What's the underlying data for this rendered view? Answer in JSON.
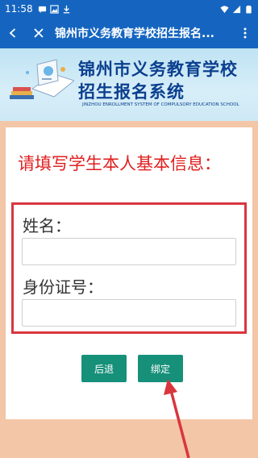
{
  "status_bar": {
    "time": "11:58",
    "left_icons": [
      "message-icon",
      "image-icon",
      "download-icon"
    ],
    "right_icons": [
      "wifi-icon",
      "signal-icon",
      "battery-icon"
    ]
  },
  "nav": {
    "title": "锦州市义务教育学校招生报名...",
    "back_icon": "chevron-left-icon",
    "close_icon": "close-icon",
    "more_icon": "more-vertical-icon"
  },
  "banner": {
    "title_line1": "锦州市义务教育学校",
    "title_line2": "招生报名系统",
    "subtitle": "JINZHOU ENROLLMENT SYSTEM OF COMPULSORY EDUCATION SCHOOL"
  },
  "form": {
    "prompt": "请填写学生本人基本信息：",
    "name_label": "姓名：",
    "name_value": "",
    "id_label": "身份证号：",
    "id_value": ""
  },
  "buttons": {
    "back_label": "后退",
    "bind_label": "绑定"
  },
  "colors": {
    "primary": "#1565c0",
    "prompt_red": "#e02020",
    "highlight_border": "#d9363e",
    "button_green": "#17907a",
    "background": "#f2c6a6"
  }
}
